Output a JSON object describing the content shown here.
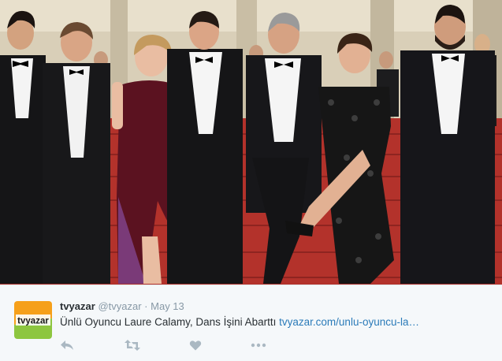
{
  "tweet": {
    "display_name": "tvyazar",
    "handle": "@tvyazar",
    "separator": "·",
    "date": "May 13",
    "text": "Ünlü Oyuncu Laure Calamy, Dans İşini Abarttı",
    "link": "tvyazar.com/unlu-oyuncu-la…"
  },
  "avatar": {
    "logo_text": "tvyazar",
    "colors": {
      "top": "#f6a01a",
      "bottom": "#8dc63f",
      "text": "#1a1a1a"
    }
  },
  "actions": [
    {
      "name": "reply-icon"
    },
    {
      "name": "retweet-icon"
    },
    {
      "name": "like-icon"
    },
    {
      "name": "more-icon"
    }
  ],
  "colors": {
    "background": "#f5f8fa",
    "name": "#292f33",
    "meta": "#8899a6",
    "link": "#2b7bb9",
    "icon": "#aab8c2"
  }
}
